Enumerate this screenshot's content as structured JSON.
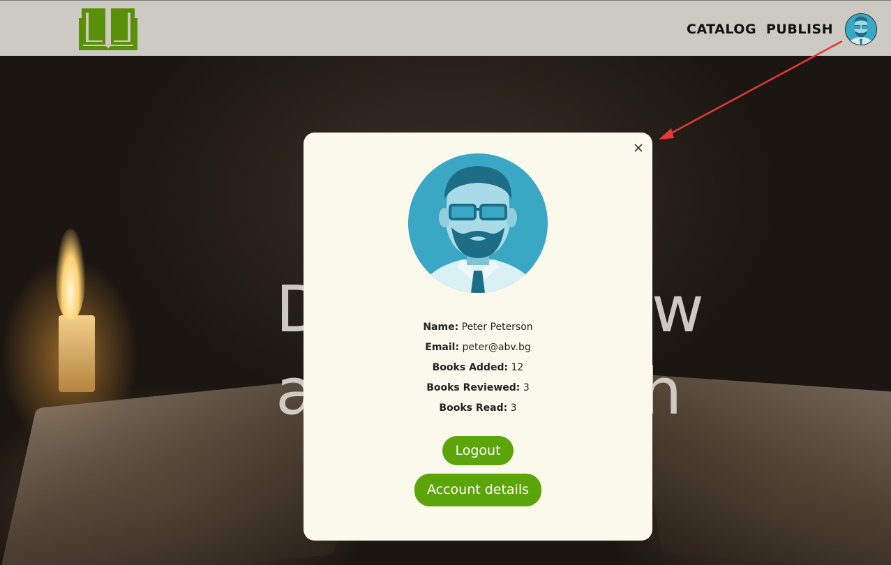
{
  "header": {
    "nav_catalog": "CATALOG",
    "nav_publish": "PUBLISH",
    "logo_icon": "open-book-icon",
    "avatar_icon": "user-avatar-icon"
  },
  "hero": {
    "line1": "D                w",
    "line2": "a                h"
  },
  "modal": {
    "close_icon": "close-icon",
    "avatar_icon": "user-avatar-icon",
    "name_label": "Name:",
    "name_value": "Peter Peterson",
    "email_label": "Email:",
    "email_value": "peter@abv.bg",
    "added_label": "Books Added:",
    "added_value": "12",
    "reviewed_label": "Books Reviewed:",
    "reviewed_value": "3",
    "read_label": "Books Read:",
    "read_value": "3",
    "logout_label": "Logout",
    "account_label": "Account details"
  },
  "colors": {
    "accent_green": "#5ba40a",
    "header_bg": "#cdc9c3",
    "modal_bg": "#fbf8ec",
    "annotation_arrow": "#e53935"
  }
}
